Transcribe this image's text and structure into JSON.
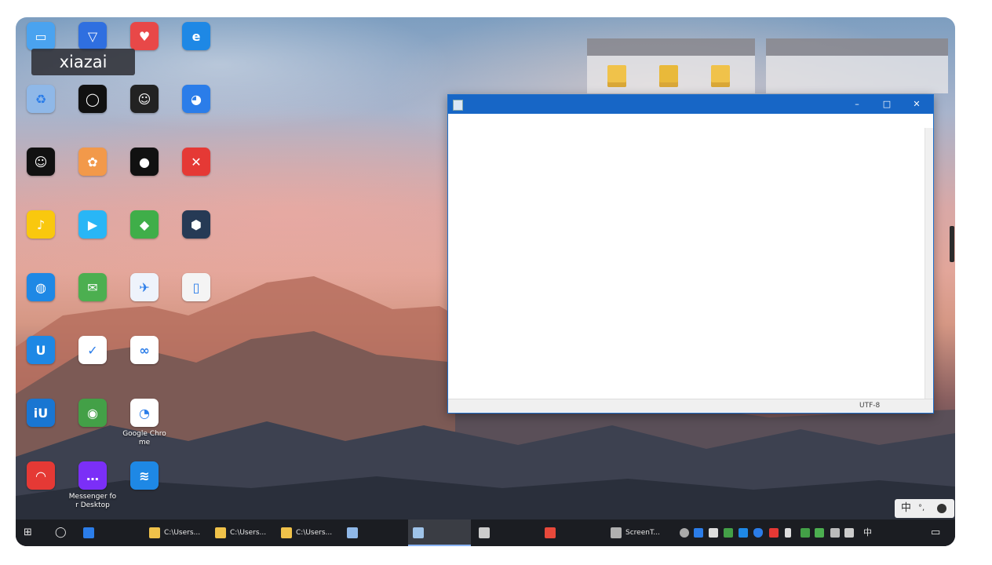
{
  "desktop": {
    "tooltip": "xiazai",
    "icons": [
      {
        "label": "",
        "color": "#4aa3f0",
        "glyph": "▭"
      },
      {
        "label": "",
        "color": "#2f6fe0",
        "glyph": "▽"
      },
      {
        "label": "",
        "color": "#e84848",
        "glyph": "♥"
      },
      {
        "label": "",
        "color": "#1e88e5",
        "glyph": "e"
      },
      {
        "label": "",
        "color": "#8fb8e8",
        "glyph": "♻"
      },
      {
        "label": "",
        "color": "#111111",
        "glyph": "◯"
      },
      {
        "label": "",
        "color": "#222222",
        "glyph": "☺"
      },
      {
        "label": "",
        "color": "#2b7de9",
        "glyph": "◕"
      },
      {
        "label": "",
        "color": "#111111",
        "glyph": "☺"
      },
      {
        "label": "",
        "color": "#f2994a",
        "glyph": "✿"
      },
      {
        "label": "",
        "color": "#111111",
        "glyph": "●"
      },
      {
        "label": "",
        "color": "#e53935",
        "glyph": "✕"
      },
      {
        "label": "",
        "color": "#f9c80e",
        "glyph": "♪"
      },
      {
        "label": "",
        "color": "#29b6f6",
        "glyph": "▶"
      },
      {
        "label": "",
        "color": "#3fae49",
        "glyph": "◆"
      },
      {
        "label": "",
        "color": "#263a55",
        "glyph": "⬢"
      },
      {
        "label": "",
        "color": "#1e88e5",
        "glyph": "◍"
      },
      {
        "label": "",
        "color": "#4caf50",
        "glyph": "✉"
      },
      {
        "label": "",
        "color": "#eef3fb",
        "glyph": "✈"
      },
      {
        "label": "",
        "color": "#f4f4f4",
        "glyph": "▯"
      },
      {
        "label": "",
        "color": "#1e88e5",
        "glyph": "U"
      },
      {
        "label": "",
        "color": "#ffffff",
        "glyph": "✓"
      },
      {
        "label": "",
        "color": "#ffffff",
        "glyph": "∞"
      },
      {
        "label": "",
        "color": "",
        "glyph": ""
      },
      {
        "label": "",
        "color": "#1976d2",
        "glyph": "iU"
      },
      {
        "label": "",
        "color": "#43a047",
        "glyph": "◉"
      },
      {
        "label": "Google Chrome",
        "color": "#ffffff",
        "glyph": "◔"
      },
      {
        "label": "",
        "color": "",
        "glyph": ""
      },
      {
        "label": "",
        "color": "#e53935",
        "glyph": "◠"
      },
      {
        "label": "Messenger for Desktop",
        "color": "#7b2ff7",
        "glyph": "…"
      },
      {
        "label": "",
        "color": "#1e88e5",
        "glyph": "≋"
      }
    ]
  },
  "explorer_panels": [
    {
      "title": ""
    },
    {
      "title": ""
    }
  ],
  "notepad": {
    "title": "",
    "menu": [
      "",
      "",
      "",
      "",
      ""
    ],
    "content": "",
    "minimize_glyph": "–",
    "maximize_glyph": "□",
    "close_glyph": "✕",
    "status": {
      "position": "",
      "zoom": "",
      "line_ending": "",
      "encoding": "UTF-8"
    }
  },
  "ime": {
    "label": "中",
    "extra": "°,"
  },
  "taskbar": {
    "start_glyph": "⊞",
    "search_glyph": "◯",
    "items": [
      {
        "label": "",
        "color": "#2b7de9"
      },
      {
        "label": "C:\\Users...",
        "color": "#f0c24a"
      },
      {
        "label": "C:\\Users...",
        "color": "#f0c24a"
      },
      {
        "label": "C:\\Users...",
        "color": "#f0c24a"
      },
      {
        "label": "",
        "color": "#8fb8e8"
      },
      {
        "label": "",
        "color": "#9fc3e8"
      },
      {
        "label": "",
        "color": "#cccccc"
      },
      {
        "label": "",
        "color": "#e8493b"
      },
      {
        "label": "ScreenT...",
        "color": "#b0b0b0"
      }
    ],
    "tray_lang": "中",
    "clock_time": "",
    "clock_date": "",
    "notification_glyph": "▭"
  }
}
